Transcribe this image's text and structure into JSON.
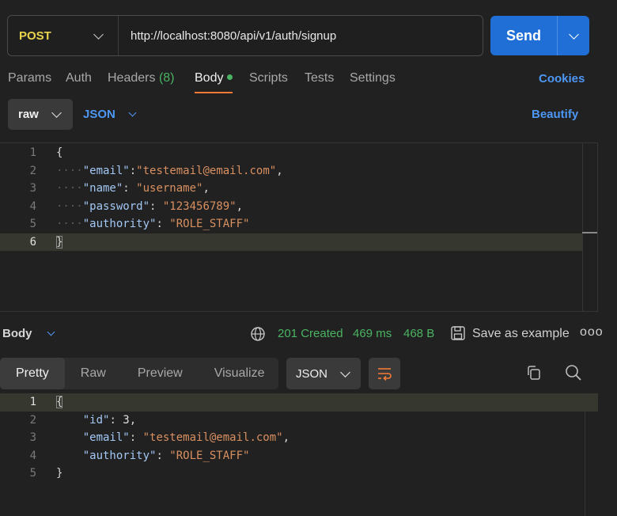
{
  "request": {
    "method": "POST",
    "url": "http://localhost:8080/api/v1/auth/signup",
    "send_label": "Send"
  },
  "tabs": [
    {
      "label": "Params"
    },
    {
      "label": "Auth"
    },
    {
      "label": "Headers",
      "count": "(8)"
    },
    {
      "label": "Body"
    },
    {
      "label": "Scripts"
    },
    {
      "label": "Tests"
    },
    {
      "label": "Settings"
    }
  ],
  "cookies_label": "Cookies",
  "body_options": {
    "mode": "raw",
    "language": "JSON",
    "beautify_label": "Beautify"
  },
  "request_body": {
    "line_numbers": [
      "1",
      "2",
      "3",
      "4",
      "5",
      "6"
    ],
    "lines": [
      "{",
      "\"email\":\"testemail@email.com\",",
      "\"name\": \"username\",",
      "\"password\": \"123456789\",",
      "\"authority\": \"ROLE_STAFF\"",
      "}"
    ],
    "fields": [
      {
        "key": "\"email\"",
        "sep": ":",
        "value": "\"testemail@email.com\"",
        "trail": ","
      },
      {
        "key": "\"name\"",
        "sep": ": ",
        "value": "\"username\"",
        "trail": ","
      },
      {
        "key": "\"password\"",
        "sep": ": ",
        "value": "\"123456789\"",
        "trail": ","
      },
      {
        "key": "\"authority\"",
        "sep": ": ",
        "value": "\"ROLE_STAFF\"",
        "trail": ""
      }
    ],
    "open_brace": "{",
    "close_brace": "}"
  },
  "response": {
    "body_label": "Body",
    "status": "201 Created",
    "time": "469 ms",
    "size": "468 B",
    "save_label": "Save as example",
    "more_label": "ooo",
    "view_tabs": [
      {
        "label": "Pretty"
      },
      {
        "label": "Raw"
      },
      {
        "label": "Preview"
      },
      {
        "label": "Visualize"
      }
    ],
    "format": "JSON",
    "line_numbers": [
      "1",
      "2",
      "3",
      "4",
      "5"
    ],
    "fields": [
      {
        "key": "\"id\"",
        "value": "3",
        "trail": ","
      },
      {
        "key": "\"email\"",
        "value": "\"testemail@email.com\"",
        "trail": ","
      },
      {
        "key": "\"authority\"",
        "value": "\"ROLE_STAFF\"",
        "trail": ""
      }
    ],
    "open_brace": "{",
    "close_brace": "}"
  },
  "colors": {
    "accent": "#1f6fd6",
    "method": "#e8d44d",
    "success": "#4bb463",
    "link": "#4d97f5",
    "active_tab_underline": "#f37b35",
    "json_key": "#a3c8f5",
    "json_string": "#d99060"
  }
}
